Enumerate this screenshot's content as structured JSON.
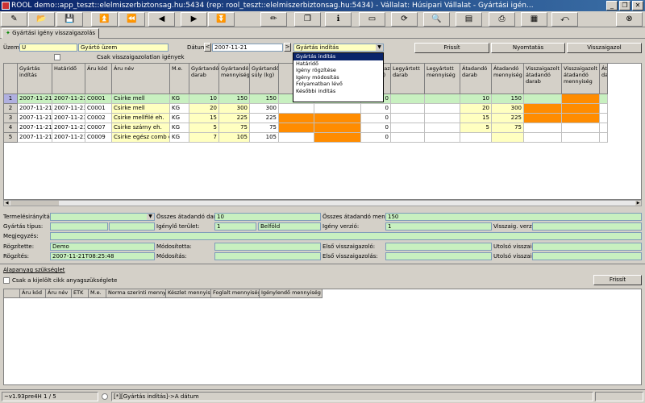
{
  "window": {
    "title": "ROOL demo::app_teszt::elelmiszerbiztonsag.hu:5434 (rep: rool_teszt::elelmiszerbiztonsag.hu:5434) - Vállalat: Húsipari Vállalat - Gyártási igén...",
    "minimize": "_",
    "restore": "❐",
    "close": "✕"
  },
  "toolbar": {
    "icons": [
      "document-pencil-icon",
      "open-folder-icon",
      "save-icon",
      "first-record-icon",
      "previous-record-icon",
      "next-record-icon",
      "last-record-icon",
      "edit-icon",
      "copy-icon",
      "info-icon",
      "window-icon",
      "refresh-icon",
      "search-icon",
      "filter-icon",
      "print-icon",
      "report-icon",
      "exit-icon",
      "close-icon"
    ],
    "glyphs": [
      "✎",
      "📂",
      "💾",
      "⏫",
      "⏪",
      "◀",
      "▶",
      "⏬",
      "✏",
      "❐",
      "ℹ",
      "▭",
      "⟳",
      "🔍",
      "▤",
      "⎙",
      "▦",
      "⤺",
      "⊗"
    ]
  },
  "tab": {
    "label": "Gyártási igény visszaigazolás"
  },
  "filters": {
    "uzem_label": "Üzem:",
    "uzem_code": "U",
    "uzem_name": "Gyártó üzem",
    "datum_label": "Dátum:",
    "datum_value": "2007-11-21",
    "prev": "<",
    "next": ">",
    "sort_value": "Gyártás indítás",
    "only_unconfirmed": "Csak visszaigazolatlan igények"
  },
  "buttons": {
    "refresh": "Frissít",
    "print": "Nyomtatás",
    "confirm": "Visszaigazol",
    "refresh2": "Frissít"
  },
  "dropdown": {
    "options": [
      "Gyártás indítás",
      "Határidő",
      "Igény rögzítése",
      "Igény módosítás",
      "Folyamatban lévő",
      "Későbbi indítás"
    ],
    "selected": 0
  },
  "grid": {
    "columns": [
      "Gyártás indítás",
      "Határidő",
      "Áru kód",
      "Áru név",
      "M.e.",
      "Gyártandó darab",
      "Gyártandó mennyiség",
      "Gyártandó súly (kg)",
      "",
      "",
      "Visszaigazolt súly (kg)",
      "Legyártott darab",
      "Legyártott mennyiség",
      "Átadandó darab",
      "Átadandó mennyiség",
      "Visszaigazolt átadandó darab",
      "Visszaigazolt átadandó mennyiség",
      "Át da"
    ],
    "rows": [
      {
        "n": "1",
        "start": "2007-11-21",
        "deadline": "2007-11-22",
        "code": "C0001",
        "name": "Csirke mell",
        "unit": "KG",
        "db": "10",
        "qty": "150",
        "kg": "150",
        "vkg": "0",
        "adb": "10",
        "aqty": "150"
      },
      {
        "n": "2",
        "start": "2007-11-21",
        "deadline": "2007-11-23",
        "code": "C0001",
        "name": "Csirke mell",
        "unit": "KG",
        "db": "20",
        "qty": "300",
        "kg": "300",
        "vkg": "0",
        "adb": "20",
        "aqty": "300"
      },
      {
        "n": "3",
        "start": "2007-11-21",
        "deadline": "2007-11-23",
        "code": "C0002",
        "name": "Csirke mellfilé eh.",
        "unit": "KG",
        "db": "15",
        "qty": "225",
        "kg": "225",
        "vkg": "0",
        "adb": "15",
        "aqty": "225"
      },
      {
        "n": "4",
        "start": "2007-11-21",
        "deadline": "2007-11-23",
        "code": "C0007",
        "name": "Csirke szárny eh.",
        "unit": "KG",
        "db": "5",
        "qty": "75",
        "kg": "75",
        "vkg": "0",
        "adb": "5",
        "aqty": "75"
      },
      {
        "n": "5",
        "start": "2007-11-21",
        "deadline": "2007-11-23",
        "code": "C0009",
        "name": "Csirke egész comb eh.",
        "unit": "KG",
        "db": "7",
        "qty": "105",
        "kg": "105",
        "vkg": "0",
        "adb": "",
        "aqty": ""
      }
    ]
  },
  "details": {
    "termeles_label": "Termelésirányítás:",
    "osszes_darab_label": "Összes átadandó darab:",
    "osszes_darab": "10",
    "osszes_menny_label": "Összes átadandó menny.:",
    "osszes_menny": "150",
    "gyartas_tipus_label": "Gyártás típus:",
    "igenylo_label": "Igénylő terület:",
    "igenylo_code": "1",
    "igenylo_name": "Belföld",
    "igeny_verzio_label": "Igény verzió:",
    "igeny_verzio": "1",
    "vissza_verzio_label": "Visszaig. verzió:",
    "megjegyzes_label": "Megjegyzés:",
    "rogzitette_label": "Rögzítette:",
    "rogzitette": "Demo",
    "modositotta_label": "Módosította:",
    "elso_vissza_label": "Első visszaigazoló:",
    "utolso_vissza_label": "Utolsó visszaig.:",
    "rogzites_label": "Rögzítés:",
    "rogzites": "2007-11-21T08:25:48",
    "modositas_label": "Módosítás:",
    "elso_vissza_ido_label": "Első visszaigazolás:",
    "utolso_vissza_ido_label": "Utolsó visszaig.:"
  },
  "needs": {
    "title": "Alapanyag szükséglet",
    "only_selected": "Csak a kijelölt cikk anyagszükséglete",
    "columns": [
      "Áru kód",
      "Áru név",
      "ETK",
      "M.e.",
      "Norma szerinti mennyiség",
      "Készlet mennyiség",
      "Foglalt mennyiség",
      "Igénylendő mennyiség"
    ]
  },
  "status": {
    "version": "~v1.93pre4H",
    "page": "1 / 5",
    "sort": "[*][Gyártás indítás]->A dátum"
  }
}
